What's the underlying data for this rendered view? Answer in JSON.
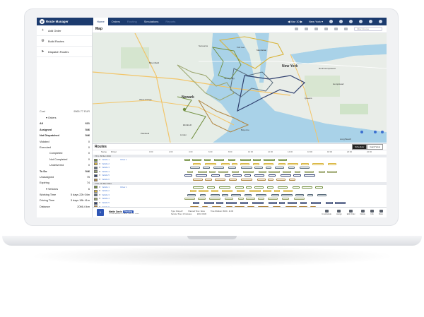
{
  "app": {
    "title": "Route Manager"
  },
  "nav": {
    "tabs": [
      "Home",
      "Orders",
      "Routing",
      "Simulations",
      "Reports"
    ],
    "active_tab": "Home",
    "date": "Mar 30",
    "region": "New York"
  },
  "sidebar": {
    "actions": [
      {
        "label": "Add Order",
        "icon": "plus-icon"
      },
      {
        "label": "Build Routes",
        "icon": "build-icon"
      },
      {
        "label": "Dispatch Routes",
        "icon": "send-icon"
      }
    ],
    "stats_header": {
      "label": "Cost",
      "value": "9565.77 EUR"
    },
    "stats": [
      {
        "label": "Orders",
        "value": "",
        "level": 0,
        "bold": false,
        "collapsible": true
      },
      {
        "label": "All",
        "value": "621",
        "level": 0,
        "bold": true
      },
      {
        "label": "Assigned",
        "value": "546",
        "level": 0,
        "bold": true
      },
      {
        "label": "Not Dispatched",
        "value": "546",
        "level": 0,
        "bold": true
      },
      {
        "label": "Violated",
        "value": "0",
        "level": 0,
        "bold": false
      },
      {
        "label": "Executed",
        "value": "0",
        "level": 0,
        "bold": false
      },
      {
        "label": "Completed",
        "value": "0",
        "level": 1,
        "bold": false
      },
      {
        "label": "Not Completed",
        "value": "0",
        "level": 1,
        "bold": false
      },
      {
        "label": "Undelivered",
        "value": "0",
        "level": 1,
        "bold": false
      },
      {
        "label": "To Do",
        "value": "546",
        "level": 0,
        "bold": true
      },
      {
        "label": "Unassigned",
        "value": "75",
        "level": 0,
        "bold": false
      },
      {
        "label": "Expiring",
        "value": "74",
        "level": 0,
        "bold": false
      },
      {
        "label": "Vehicles",
        "value": "6",
        "level": 0,
        "bold": false,
        "collapsible": true
      },
      {
        "label": "Working Time",
        "value": "5 days 22h 04m",
        "level": 0,
        "bold": false
      },
      {
        "label": "Driving Time",
        "value": "3 days 18h 41m",
        "level": 0,
        "bold": false
      },
      {
        "label": "Distance",
        "value": "2066.4 km",
        "level": 0,
        "bold": false
      }
    ]
  },
  "map": {
    "title": "Map",
    "filter_placeholder": "Filter Routes",
    "labels": [
      "Secaucus",
      "Bloomfield",
      "Newark",
      "West Orange",
      "Elizabeth",
      "Plainfield",
      "Linden",
      "New York",
      "Hempstead",
      "Bayonne",
      "North Hempstead",
      "Queens",
      "Jersey City",
      "Manhattan",
      "Fort Lee",
      "Long Beach"
    ]
  },
  "routes": {
    "title": "Routes",
    "view_options": [
      "Scheduler",
      "Gantt View"
    ],
    "active_view": "Scheduler",
    "columns": [
      "Name",
      "Driver"
    ],
    "times": [
      "0:00",
      "2:00",
      "4:00",
      "6:00",
      "8:00",
      "10:00",
      "12:00",
      "14:00",
      "16:00",
      "18:00",
      "20:00",
      "22:00"
    ],
    "groups": [
      {
        "date": "Fri, 29 Mar 2024",
        "rows": [
          {
            "color": "#6f8d3c",
            "name": "Vehicle 1",
            "driver": "Driver 1"
          },
          {
            "color": "#d9b43a",
            "name": "Vehicle 2",
            "driver": ""
          },
          {
            "color": "#5b6e7d",
            "name": "Vehicle 3",
            "driver": ""
          },
          {
            "color": "#9aa56c",
            "name": "Vehicle 4",
            "driver": ""
          },
          {
            "color": "#2f3f6e",
            "name": "Vehicle 5",
            "driver": ""
          },
          {
            "color": "#b0853f",
            "name": "Vehicle 6",
            "driver": ""
          }
        ]
      },
      {
        "date": "Sat, 30 Mar 2024",
        "rows": [
          {
            "color": "#6f8d3c",
            "name": "Vehicle 1",
            "driver": "Driver 1"
          },
          {
            "color": "#d9b43a",
            "name": "Vehicle 2",
            "driver": ""
          },
          {
            "color": "#5b6e7d",
            "name": "Vehicle 3",
            "driver": ""
          },
          {
            "color": "#9aa56c",
            "name": "Vehicle 4",
            "driver": ""
          },
          {
            "color": "#2f3f6e",
            "name": "Vehicle 5",
            "driver": ""
          },
          {
            "color": "#b0853f",
            "name": "Vehicle 6",
            "driver": ""
          }
        ]
      }
    ]
  },
  "bottom": {
    "badge": "1",
    "name": "Mattie Davis",
    "status": "Pending",
    "address": "123 BROADWAY ST NEW YORK NY 10001",
    "type": "Type: Drop-off",
    "planned": "Planned Time: None",
    "window": "Time Window: 09:00 - 11:00",
    "service": "Service Time: 15 minutes",
    "eta": "ETA: 09:30",
    "actions": [
      "Unschedule",
      "Assign",
      "Edit Order",
      "Delete",
      "Info",
      "More"
    ]
  },
  "colors": {
    "navy": "#1c3b6e",
    "accent": "#2f56b5",
    "link": "#3b6fd0"
  }
}
